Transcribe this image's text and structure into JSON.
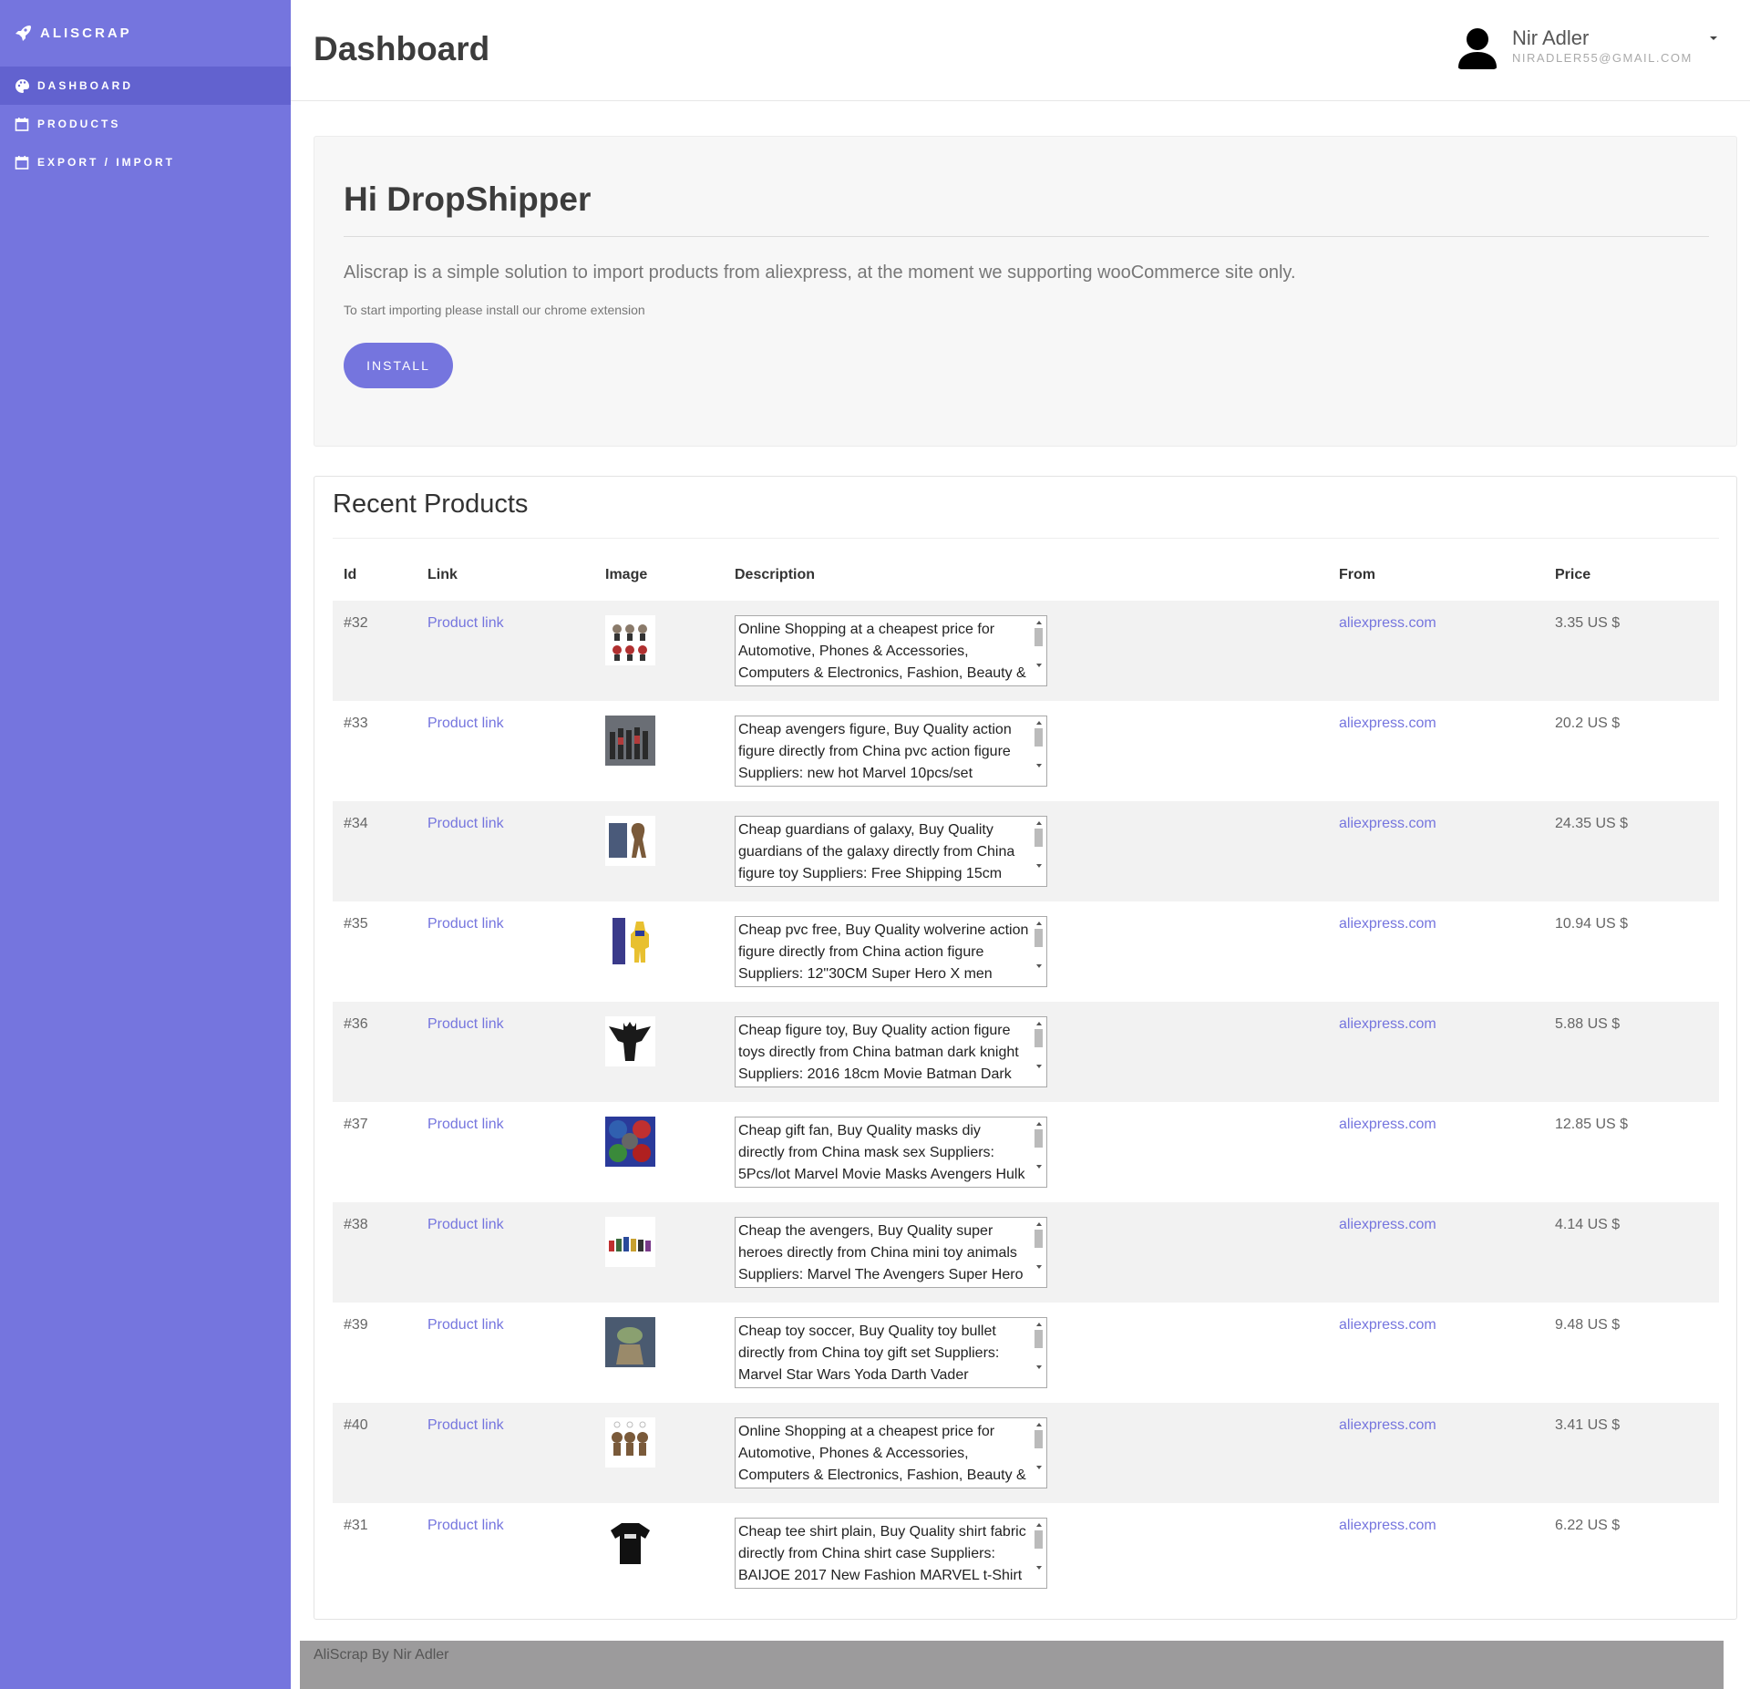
{
  "brand": {
    "name": "ALISCRAP",
    "icon": "rocket-icon"
  },
  "sidebar": {
    "items": [
      {
        "label": "DASHBOARD",
        "icon": "palette-icon",
        "active": true
      },
      {
        "label": "PRODUCTS",
        "icon": "calendar-icon",
        "active": false
      },
      {
        "label": "EXPORT / IMPORT",
        "icon": "calendar-icon",
        "active": false
      }
    ]
  },
  "header": {
    "title": "Dashboard",
    "user": {
      "name": "Nir Adler",
      "email": "NIRADLER55@GMAIL.COM",
      "avatar_icon": "user-silhouette-icon"
    }
  },
  "hero": {
    "title": "Hi DropShipper",
    "lead": "Aliscrap is a simple solution to import products from aliexpress, at the moment we supporting wooCommerce site only.",
    "note": "To start importing please install our chrome extension",
    "button": "INSTALL"
  },
  "products": {
    "title": "Recent Products",
    "columns": [
      "Id",
      "Link",
      "Image",
      "Description",
      "From",
      "Price"
    ],
    "rows": [
      {
        "id": "#32",
        "link": "Product link",
        "image": "funko-keychains-thumbnail",
        "description": "Online Shopping at a cheapest price for Automotive, Phones & Accessories, Computers & Electronics, Fashion, Beauty &",
        "from": "aliexpress.com",
        "price": "3.35 US $"
      },
      {
        "id": "#33",
        "link": "Product link",
        "image": "avengers-figures-thumbnail",
        "description": "Cheap avengers figure, Buy Quality action figure directly from China pvc action figure Suppliers: new hot Marvel 10pcs/set",
        "from": "aliexpress.com",
        "price": "20.2 US $"
      },
      {
        "id": "#34",
        "link": "Product link",
        "image": "groot-figure-thumbnail",
        "description": "Cheap guardians of galaxy, Buy Quality guardians of the galaxy directly from China figure toy Suppliers: Free Shipping 15cm",
        "from": "aliexpress.com",
        "price": "24.35 US $"
      },
      {
        "id": "#35",
        "link": "Product link",
        "image": "wolverine-figure-thumbnail",
        "description": "Cheap pvc free, Buy Quality wolverine action figure directly from China action figure Suppliers: 12\"30CM Super Hero X men",
        "from": "aliexpress.com",
        "price": "10.94 US $"
      },
      {
        "id": "#36",
        "link": "Product link",
        "image": "batman-figure-thumbnail",
        "description": "Cheap figure toy, Buy Quality action figure toys directly from China batman dark knight Suppliers: 2016 18cm Movie Batman Dark",
        "from": "aliexpress.com",
        "price": "5.88 US $"
      },
      {
        "id": "#37",
        "link": "Product link",
        "image": "masks-thumbnail",
        "description": "Cheap gift fan, Buy Quality masks diy directly from China mask sex Suppliers: 5Pcs/lot Marvel Movie Masks Avengers Hulk",
        "from": "aliexpress.com",
        "price": "12.85 US $"
      },
      {
        "id": "#38",
        "link": "Product link",
        "image": "mini-heroes-thumbnail",
        "description": "Cheap the avengers, Buy Quality super heroes directly from China mini toy animals Suppliers: Marvel The Avengers Super Hero",
        "from": "aliexpress.com",
        "price": "4.14 US $"
      },
      {
        "id": "#39",
        "link": "Product link",
        "image": "yoda-figure-thumbnail",
        "description": "Cheap toy soccer, Buy Quality toy bullet directly from China toy gift set Suppliers: Marvel Star Wars Yoda Darth Vader",
        "from": "aliexpress.com",
        "price": "9.48 US $"
      },
      {
        "id": "#40",
        "link": "Product link",
        "image": "groot-keychains-thumbnail",
        "description": "Online Shopping at a cheapest price for Automotive, Phones & Accessories, Computers & Electronics, Fashion, Beauty &",
        "from": "aliexpress.com",
        "price": "3.41 US $"
      },
      {
        "id": "#31",
        "link": "Product link",
        "image": "tshirt-thumbnail",
        "description": "Cheap tee shirt plain, Buy Quality shirt fabric directly from China shirt case Suppliers: BAIJOE 2017 New Fashion MARVEL t-Shirt",
        "from": "aliexpress.com",
        "price": "6.22 US $"
      }
    ]
  },
  "footer": {
    "text": "AliScrap By Nir Adler"
  },
  "colors": {
    "accent": "#7575de",
    "sidebar_active": "#6262cf",
    "footer": "#9c9b9c"
  }
}
